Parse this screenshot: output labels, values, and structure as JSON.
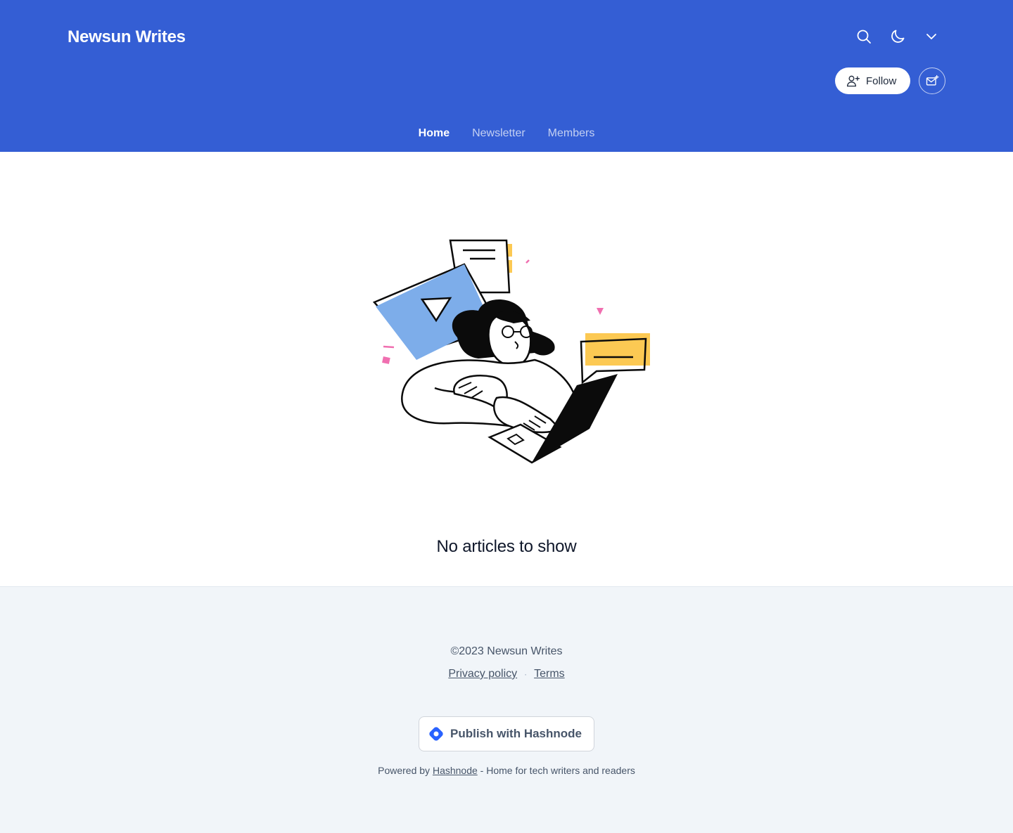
{
  "header": {
    "blog_title": "Newsun Writes",
    "background_color": "#345ed4",
    "icons": [
      "search-icon",
      "moon-icon",
      "chevron-down-icon"
    ],
    "follow_label": "Follow",
    "newsletter_icon": "mail-plus-icon"
  },
  "nav": {
    "tabs": [
      {
        "label": "Home",
        "active": true
      },
      {
        "label": "Newsletter",
        "active": false
      },
      {
        "label": "Members",
        "active": false
      }
    ]
  },
  "main": {
    "empty_message": "No articles to show",
    "illustration": "person-writing-on-laptop"
  },
  "footer": {
    "copyright": "©2023 Newsun Writes",
    "links": [
      "Privacy policy",
      "Terms"
    ],
    "separator": "·",
    "publish_label": "Publish with Hashnode",
    "powered_prefix": "Powered by",
    "powered_link": "Hashnode",
    "powered_suffix": "- Home for tech writers and readers",
    "background_color": "#f1f5f9"
  }
}
